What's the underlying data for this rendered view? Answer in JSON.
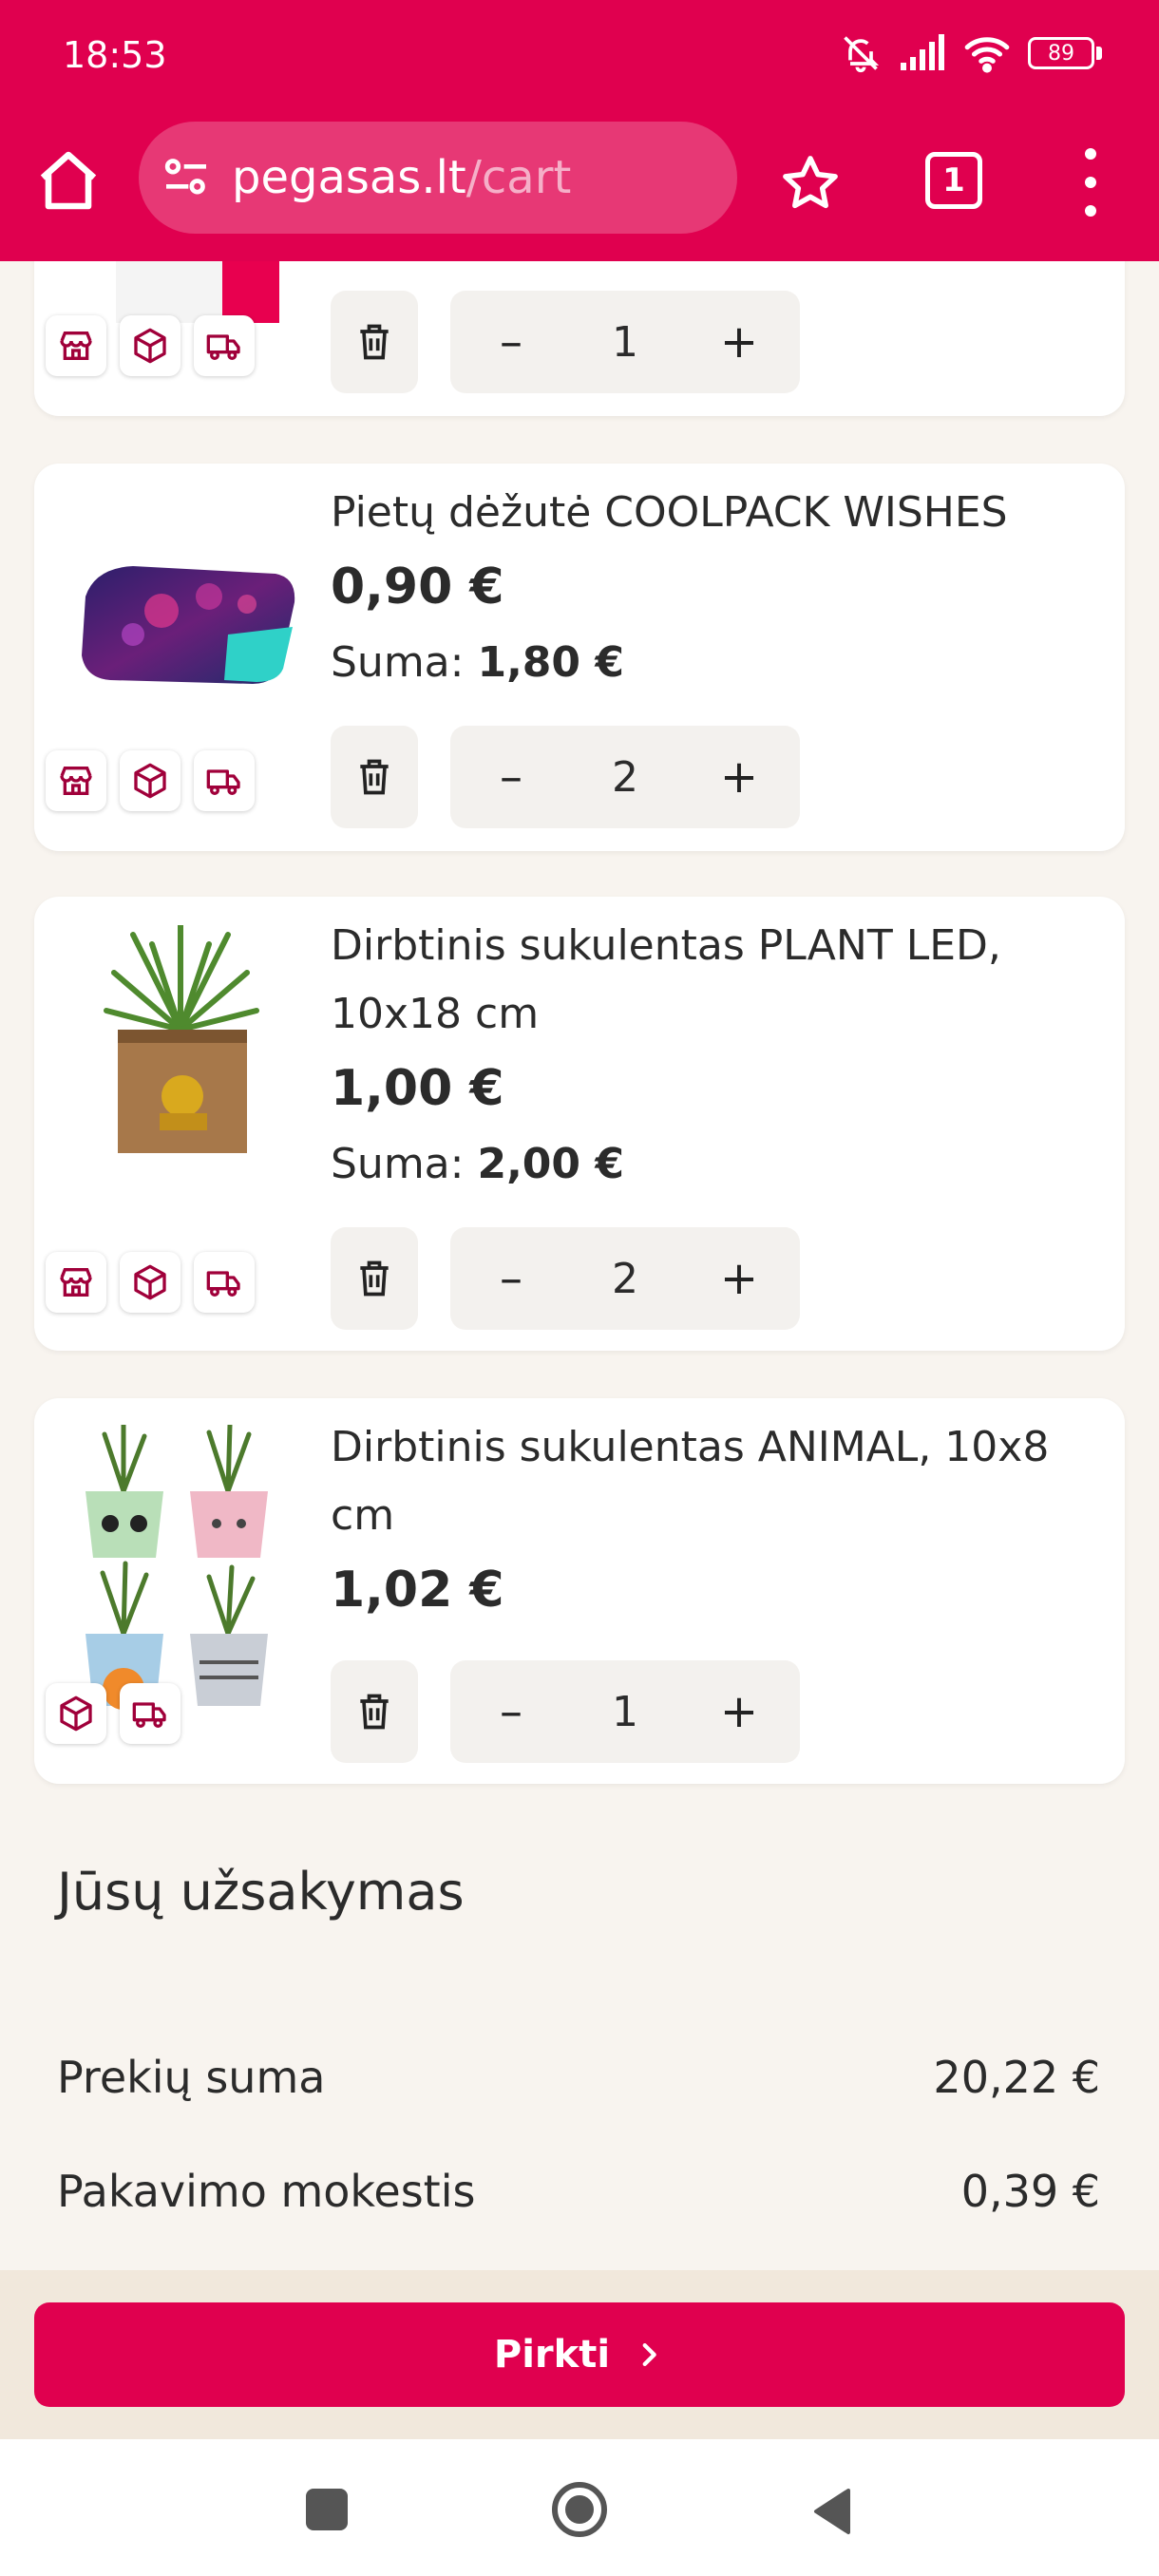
{
  "status_bar": {
    "time": "18:53",
    "battery": "89"
  },
  "browser": {
    "url_host": "pegasas.lt",
    "url_path": "/cart",
    "tab_count": "1"
  },
  "cart": {
    "items": [
      {
        "name": "",
        "price": "",
        "sum_label": "",
        "sum_value": "",
        "quantity": "1",
        "minus": "–",
        "plus": "+"
      },
      {
        "name": "Pietų dėžutė COOLPACK WISHES",
        "price": "0,90 €",
        "sum_label": "Suma:",
        "sum_value": "1,80 €",
        "quantity": "2",
        "minus": "–",
        "plus": "+"
      },
      {
        "name": "Dirbtinis sukulentas PLANT LED, 10x18 cm",
        "price": "1,00 €",
        "sum_label": "Suma:",
        "sum_value": "2,00 €",
        "quantity": "2",
        "minus": "–",
        "plus": "+"
      },
      {
        "name": "Dirbtinis sukulentas ANIMAL, 10x8 cm",
        "price": "1,02 €",
        "quantity": "1",
        "minus": "–",
        "plus": "+"
      }
    ]
  },
  "summary": {
    "title": "Jūsų užsakymas",
    "rows": [
      {
        "label": "Prekių suma",
        "value": "20,22 €"
      },
      {
        "label": "Pakavimo mokestis",
        "value": "0,39 €"
      }
    ]
  },
  "buy_button": {
    "label": "Pirkti"
  },
  "colors": {
    "brand": "#e0004f",
    "background": "#f8f4ef"
  },
  "icons": [
    "home-icon",
    "site-settings-icon",
    "star-icon",
    "tabs-icon",
    "more-icon",
    "store-icon",
    "box-icon",
    "truck-icon",
    "trash-icon",
    "chevron-right-icon"
  ]
}
